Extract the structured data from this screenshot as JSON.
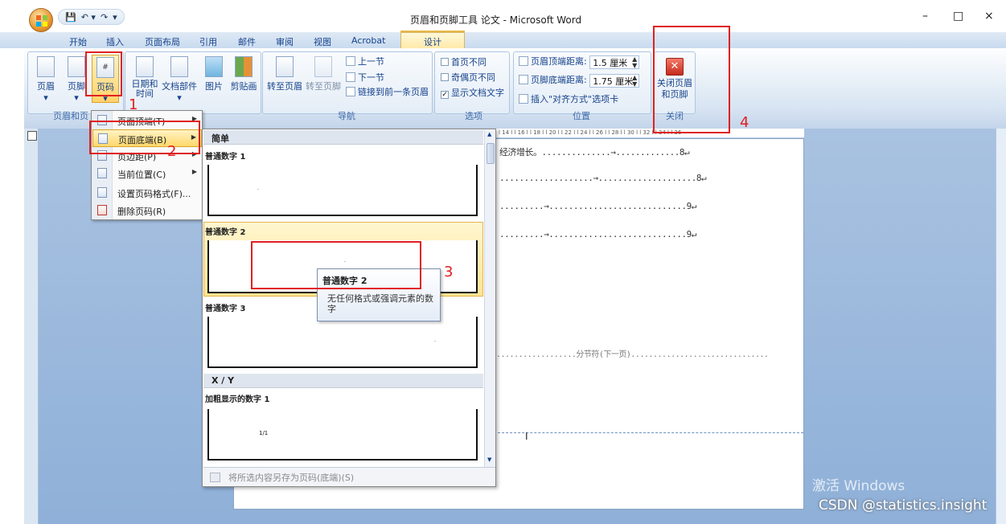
{
  "window": {
    "title_contextual": "页眉和页脚工具",
    "title_doc": "论文 - Microsoft Word",
    "minimize": "–",
    "maximize": "□",
    "close": "×"
  },
  "qat": {
    "save": "💾",
    "undo": "↶ ▾",
    "redo": "↷",
    "customize": "▾"
  },
  "tabs": [
    "开始",
    "插入",
    "页面布局",
    "引用",
    "邮件",
    "审阅",
    "视图",
    "Acrobat"
  ],
  "active_tab": "设计",
  "ribbon": {
    "header_footer": {
      "header": "页眉",
      "footer": "页脚",
      "page_number": "页码",
      "group_label": "页眉和页"
    },
    "insert": {
      "date_time": "日期和\n时间",
      "quick_parts": "文档部件",
      "picture": "图片",
      "clip_art": "剪贴画"
    },
    "nav": {
      "goto_header": "转至页眉",
      "goto_footer": "转至页脚",
      "prev": "上一节",
      "next": "下一节",
      "link_prev": "链接到前一条页眉",
      "group_label": "导航"
    },
    "options": {
      "diff_first": "首页不同",
      "diff_odd_even": "奇偶页不同",
      "show_text": "显示文档文字",
      "show_text_checked": "✓",
      "group_label": "选项"
    },
    "position": {
      "header_dist_label": "页眉顶端距离:",
      "header_dist_value": "1.5 厘米",
      "footer_dist_label": "页脚底端距离:",
      "footer_dist_value": "1.75 厘米",
      "insert_align_tab": "插入\"对齐方式\"选项卡",
      "group_label": "位置"
    },
    "close": {
      "close_label": "关闭页眉\n和页脚",
      "group_label": "关闭"
    }
  },
  "page_number_menu": [
    {
      "label": "页面顶端(T)",
      "submenu": true
    },
    {
      "label": "页面底端(B)",
      "submenu": true,
      "selected": true
    },
    {
      "label": "页边距(P)",
      "submenu": true
    },
    {
      "label": "当前位置(C)",
      "submenu": true
    },
    {
      "label": "设置页码格式(F)...",
      "submenu": false
    },
    {
      "label": "删除页码(R)",
      "submenu": false
    }
  ],
  "gallery": {
    "section_simple": "简单",
    "item1": "普通数字 1",
    "item2": "普通数字 2",
    "item3": "普通数字 3",
    "section_xy": "X / Y",
    "item4": "加粗显示的数字 1",
    "thumb4_text": "1/1",
    "footer": "将所选内容另存为页码(底端)(S)"
  },
  "tooltip": {
    "title": "普通数字 2",
    "desc": "无任何格式或强调元素的数字"
  },
  "document": {
    "line1": "经济增长。..............→.............8↵",
    "line2": "...................→....................8↵",
    "line3": ".........→............................9↵",
    "line4": ".........→............................9↵",
    "section_break": "..................分节符(下一页)...............................",
    "ruler": "l 14 l  l 16 l  l 18 l  l 20 l  l 22 l  l 24 l  l 26 l  l 28 l  l 30 l  l 32 l  l 34 l  l 36"
  },
  "annotations": [
    "1",
    "2",
    "3",
    "4"
  ],
  "overlay": {
    "activate_windows": "激活 Windows",
    "csdn": "CSDN @statistics.insight"
  }
}
